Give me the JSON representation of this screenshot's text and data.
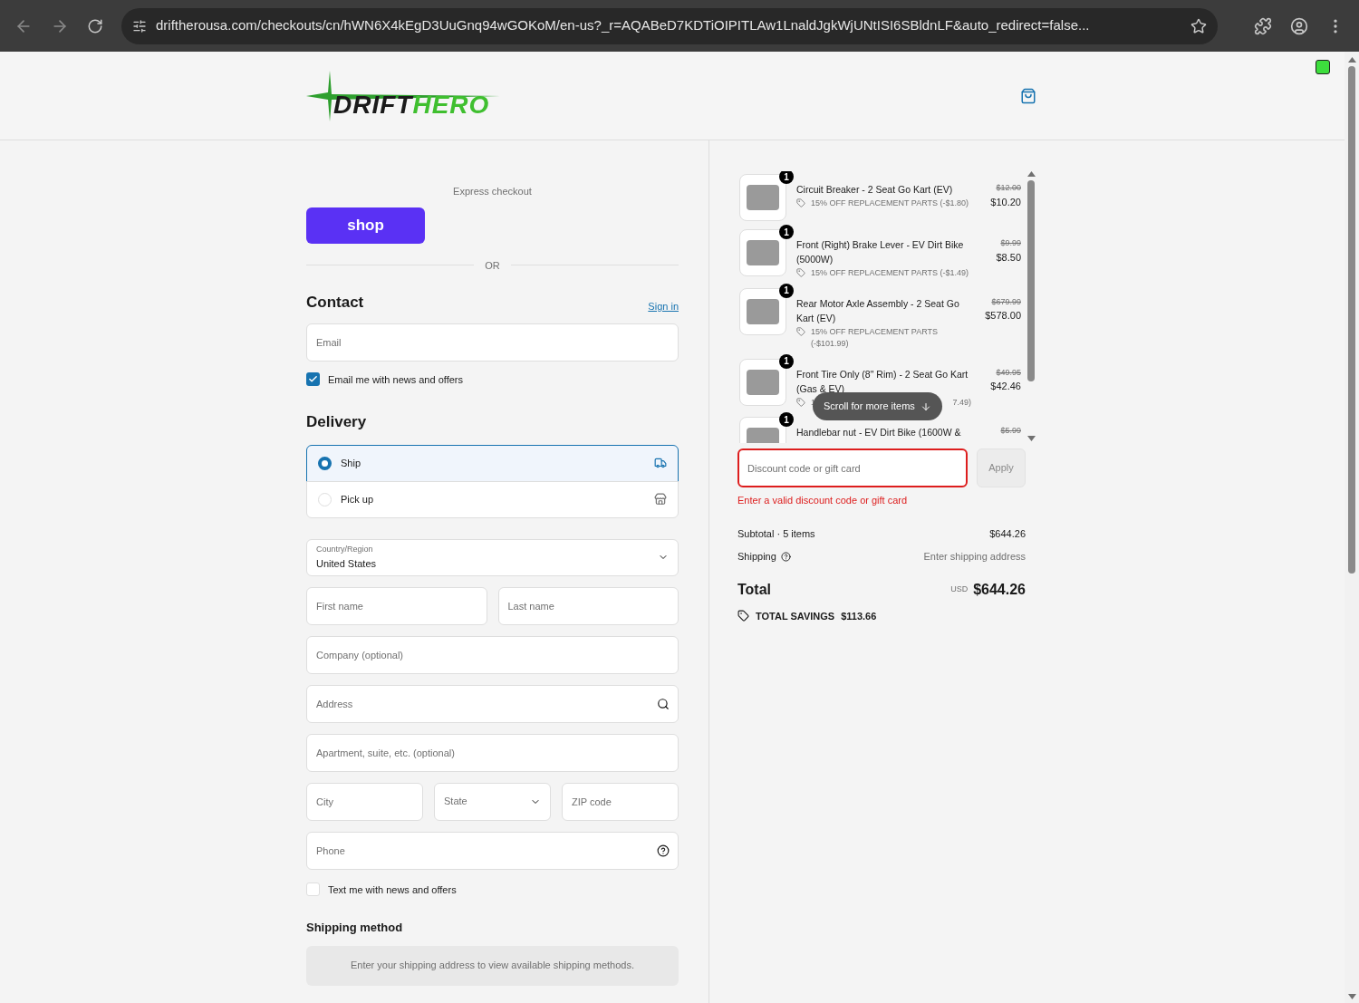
{
  "browser": {
    "url": "driftherousa.com/checkouts/cn/hWN6X4kEgD3UuGnq94wGOKoM/en-us?_r=AQABeD7KDTiOIPITLAw1LnaldJgkWjUNtISI6SBldnLF&auto_redirect=false..."
  },
  "header": {
    "logo": {
      "part_1": "DRIFT",
      "part_2": "HERO"
    }
  },
  "express": {
    "label": "Express checkout",
    "shop_button": "shop",
    "or": "OR"
  },
  "contact": {
    "title": "Contact",
    "sign_in": "Sign in",
    "email_placeholder": "Email",
    "newsletter": {
      "label": "Email me with news and offers",
      "checked": true
    }
  },
  "delivery": {
    "title": "Delivery",
    "options": [
      {
        "label": "Ship",
        "selected": true,
        "kind": "ship"
      },
      {
        "label": "Pick up",
        "selected": false,
        "kind": "pickup"
      }
    ]
  },
  "address": {
    "country_label": "Country/Region",
    "country_value": "United States",
    "first_name": {
      "placeholder": "First name"
    },
    "last_name": {
      "placeholder": "Last name"
    },
    "company": {
      "placeholder": "Company (optional)"
    },
    "address": {
      "placeholder": "Address"
    },
    "apartment": {
      "placeholder": "Apartment, suite, etc. (optional)"
    },
    "city": {
      "placeholder": "City"
    },
    "state": "State",
    "zip": {
      "placeholder": "ZIP code"
    },
    "phone": {
      "placeholder": "Phone"
    }
  },
  "sms": {
    "label": "Text me with news and offers",
    "checked": false
  },
  "shipping_method": {
    "title": "Shipping method",
    "message": "Enter your shipping address to view available shipping methods."
  },
  "cart": {
    "items": [
      {
        "qty": "1",
        "name": "Circuit Breaker - 2 Seat Go Kart (EV)",
        "original_price": "$12.00",
        "price": "$10.20",
        "discount_parts": [
          "15% OFF REPLACEMENT PARTS (-$1.80)"
        ]
      },
      {
        "qty": "1",
        "name": "Front (Right) Brake Lever - EV Dirt Bike (5000W)",
        "original_price": "$9.99",
        "price": "$8.50",
        "discount_parts": [
          "15% OFF REPLACEMENT PARTS (-$1.49)"
        ]
      },
      {
        "qty": "1",
        "name": "Rear Motor Axle Assembly - 2 Seat Go Kart (EV)",
        "original_price": "$679.99",
        "price": "$578.00",
        "discount_parts": [
          "15% OFF REPLACEMENT PARTS (-$101.99)"
        ]
      },
      {
        "qty": "1",
        "name": "Front Tire Only (8\" Rim) - 2 Seat Go Kart (Gas & EV)",
        "original_price": "$49.95",
        "price": "$42.46",
        "discount_parts": [
          "1",
          "7.49)"
        ]
      },
      {
        "qty": "1",
        "name": "Handlebar nut - EV Dirt Bike (1600W &",
        "original_price": "$5.99"
      }
    ],
    "scroll_hint": "Scroll for more items"
  },
  "discount": {
    "placeholder": "Discount code or gift card",
    "apply": "Apply",
    "error": "Enter a valid discount code or gift card"
  },
  "summary": {
    "subtotal_label": "Subtotal · 5 items",
    "subtotal": "$644.26",
    "shipping_label": "Shipping",
    "shipping_value": "Enter shipping address",
    "total_label": "Total",
    "currency": "USD",
    "total": "$644.26",
    "savings_label": "TOTAL SAVINGS",
    "savings": "$113.66"
  }
}
